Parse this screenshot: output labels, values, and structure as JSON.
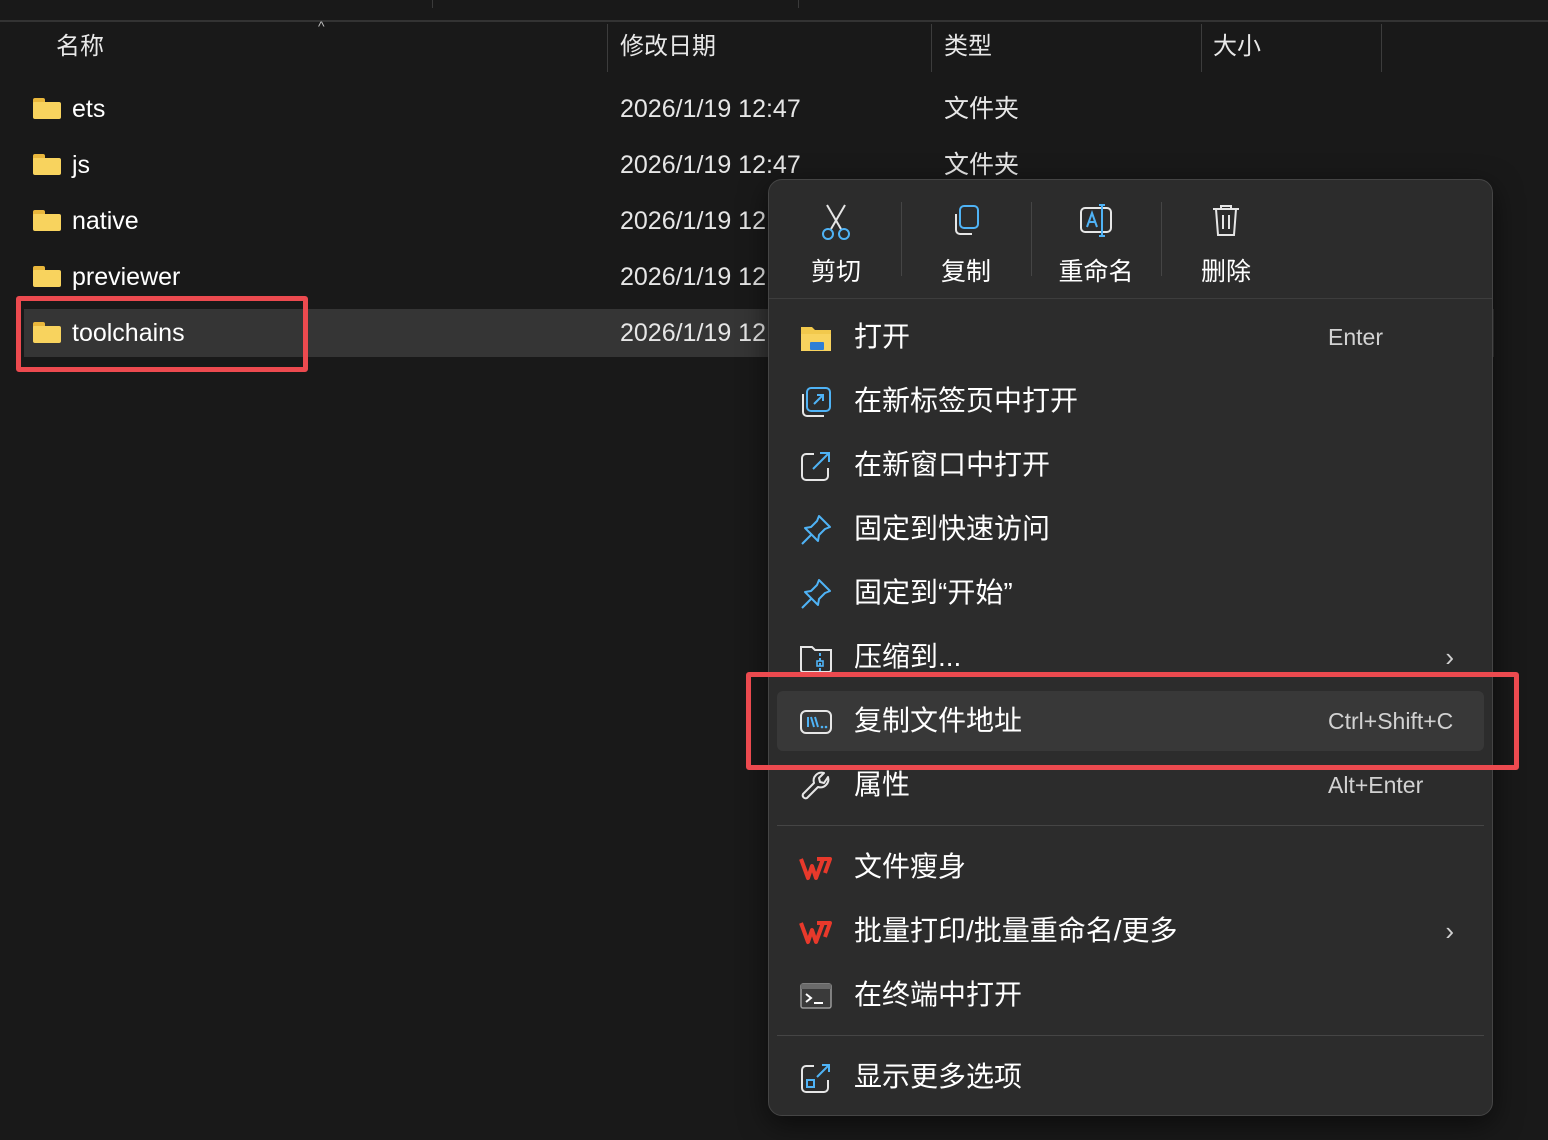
{
  "columns": {
    "name": "名称",
    "modified": "修改日期",
    "type": "类型",
    "size": "大小"
  },
  "sort_indicator": "^",
  "files": [
    {
      "name": "ets",
      "modified": "2026/1/19 12:47",
      "type": "文件夹"
    },
    {
      "name": "js",
      "modified": "2026/1/19 12:47",
      "type": "文件夹"
    },
    {
      "name": "native",
      "modified": "2026/1/19 12",
      "type": ""
    },
    {
      "name": "previewer",
      "modified": "2026/1/19 12",
      "type": ""
    },
    {
      "name": "toolchains",
      "modified": "2026/1/19 12",
      "type": "",
      "selected": true
    }
  ],
  "context_menu": {
    "top_actions": [
      {
        "label": "剪切",
        "icon": "scissors-icon"
      },
      {
        "label": "复制",
        "icon": "copy-icon"
      },
      {
        "label": "重命名",
        "icon": "rename-icon"
      },
      {
        "label": "删除",
        "icon": "trash-icon"
      }
    ],
    "items": [
      {
        "label": "打开",
        "shortcut": "Enter",
        "icon": "folder-open-icon"
      },
      {
        "label": "在新标签页中打开",
        "shortcut": "",
        "icon": "new-tab-icon"
      },
      {
        "label": "在新窗口中打开",
        "shortcut": "",
        "icon": "new-window-icon"
      },
      {
        "label": "固定到快速访问",
        "shortcut": "",
        "icon": "pin-icon"
      },
      {
        "label": "固定到“开始”",
        "shortcut": "",
        "icon": "pin-start-icon"
      },
      {
        "label": "压缩到...",
        "shortcut": "",
        "icon": "zip-icon",
        "submenu": "›"
      },
      {
        "label": "复制文件地址",
        "shortcut": "Ctrl+Shift+C",
        "icon": "copy-path-icon",
        "active": true
      },
      {
        "label": "属性",
        "shortcut": "Alt+Enter",
        "icon": "wrench-icon"
      },
      {
        "label": "文件瘦身",
        "shortcut": "",
        "icon": "wps-icon"
      },
      {
        "label": "批量打印/批量重命名/更多",
        "shortcut": "",
        "icon": "wps-icon",
        "submenu": "›"
      },
      {
        "label": "在终端中打开",
        "shortcut": "",
        "icon": "terminal-icon"
      },
      {
        "label": "显示更多选项",
        "shortcut": "",
        "icon": "show-more-icon"
      }
    ]
  },
  "colors": {
    "background": "#191919",
    "selected_row": "#353535",
    "menu_background": "#2c2c2c",
    "folder_yellow": "#f8d35e",
    "accent_blue": "#4fb3f6",
    "wps_red": "#e8392b",
    "highlight_red": "#ec4a4f"
  }
}
